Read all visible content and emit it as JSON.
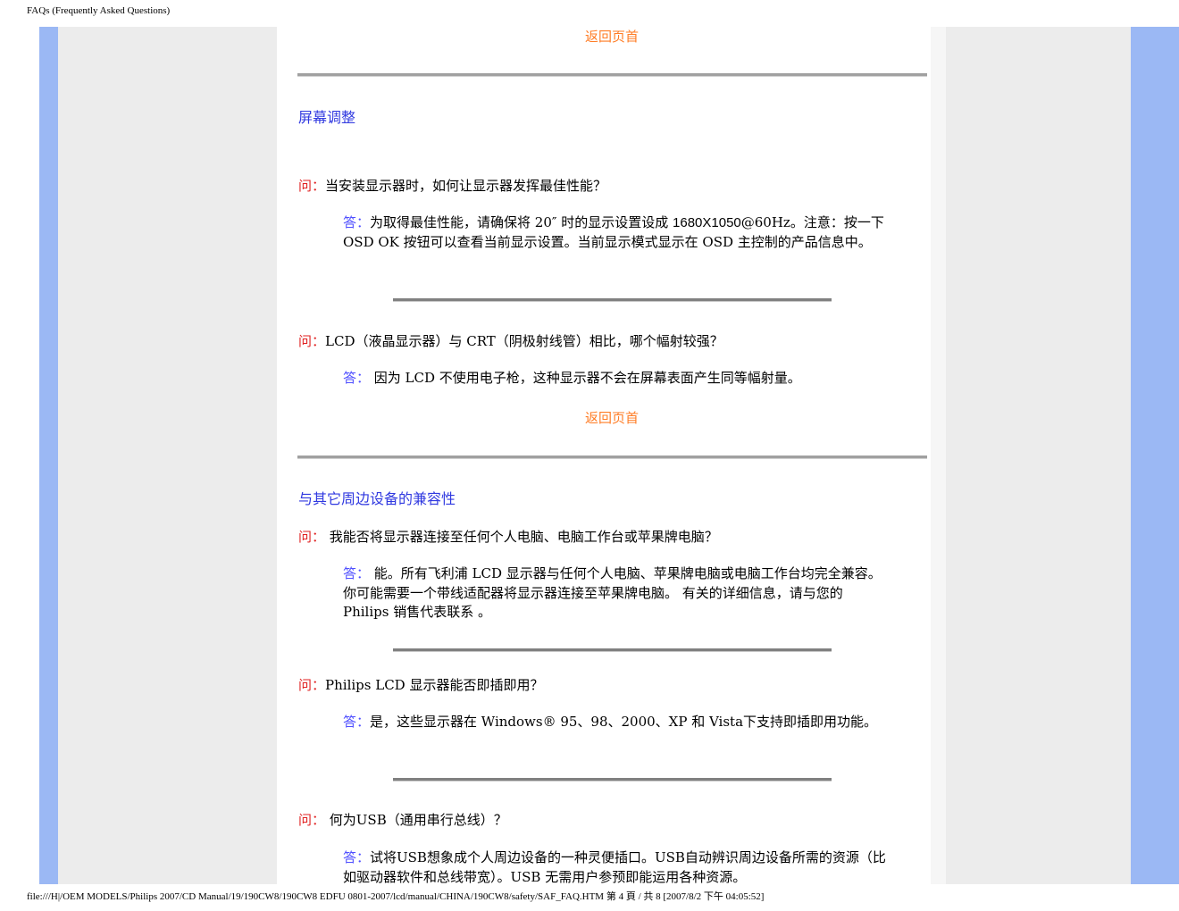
{
  "header": {
    "text": "FAQs (Frequently Asked Questions)"
  },
  "back_to_top": "返回页首",
  "sections": {
    "screen": {
      "title": "屏幕调整",
      "q1": {
        "qlabel": "问：",
        "question": "当安装显示器时，如何让显示器发挥最佳性能？",
        "alabel": "答：",
        "answer_pre": "为取得最佳性能，请确保将 20″ 时的显示设置设成 ",
        "answer_res": "1680X1050",
        "answer_post": "@60Hz。注意：按一下 OSD OK 按钮可以查看当前显示设置。当前显示模式显示在 OSD 主控制的产品信息中。"
      },
      "q2": {
        "qlabel": "问：",
        "question": "LCD（液晶显示器）与 CRT（阴极射线管）相比，哪个幅射较强？",
        "alabel": "答：",
        "answer": " 因为 LCD 不使用电子枪，这种显示器不会在屏幕表面产生同等幅射量。"
      }
    },
    "compat": {
      "title": "与其它周边设备的兼容性",
      "q1": {
        "qlabel": "问：",
        "question": " 我能否将显示器连接至任何个人电脑、电脑工作台或苹果牌电脑？",
        "alabel": "答：",
        "answer": " 能。所有飞利浦 LCD 显示器与任何个人电脑、苹果牌电脑或电脑工作台均完全兼容。你可能需要一个带线适配器将显示器连接至苹果牌电脑。 有关的详细信息，请与您的 Philips 销售代表联系 。"
      },
      "q2": {
        "qlabel": "问：",
        "question": "Philips LCD 显示器能否即插即用？",
        "alabel": "答：",
        "answer": "是，这些显示器在 Windows® 95、98、2000、XP 和 Vista下支持即插即用功能。"
      },
      "q3": {
        "qlabel": "问：",
        "question": " 何为USB（通用串行总线）？",
        "alabel": "答：",
        "answer": "试将USB想象成个人周边设备的一种灵便插口。USB自动辨识周边设备所需的资源（比如驱动器软件和总线带宽）。USB 无需用户参预即能运用各种资源。"
      }
    }
  },
  "footer": {
    "text": "file:///H|/OEM MODELS/Philips 2007/CD Manual/19/190CW8/190CW8 EDFU 0801-2007/lcd/manual/CHINA/190CW8/safety/SAF_FAQ.HTM 第 4 頁 / 共 8 [2007/8/2 下午 04:05:52]"
  },
  "colors": {
    "side_blue": "#9bb8f4",
    "side_gray": "#ececec",
    "link_orange": "#ff7d26",
    "question_red": "#e02020",
    "answer_blue": "#5050ff",
    "heading_blue": "#3039e0"
  }
}
